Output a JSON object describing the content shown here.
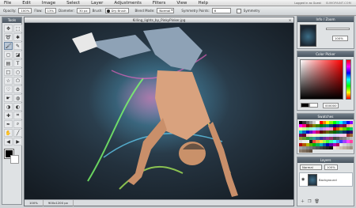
{
  "menu": {
    "items": [
      "File",
      "Edit",
      "Image",
      "Select",
      "Layer",
      "Adjustments",
      "Filters",
      "View",
      "Help"
    ],
    "logged_in": "Logged in as Guest",
    "brand": "SUMOPAINT.COM"
  },
  "options": {
    "opacity_label": "Opacity:",
    "opacity_value": "100%",
    "flow_label": "Flow:",
    "flow_value": "13%",
    "diameter_label": "Diameter:",
    "diameter_value": "30 px",
    "brush_label": "Brush:",
    "brush_value": "Dry Brush",
    "blend_label": "Blend Mode:",
    "blend_value": "Normal",
    "symmetry_points_label": "Symmetry Points:",
    "symmetry_points_value": "6",
    "symmetry_label": "Symmetry"
  },
  "tools": {
    "title": "Tools",
    "icons": [
      "move-icon",
      "marquee-icon",
      "lasso-icon",
      "magic-wand-icon",
      "brush-icon",
      "pencil-icon",
      "eraser-icon",
      "bucket-icon",
      "gradient-icon",
      "text-icon",
      "shape-rect-icon",
      "shape-ellipse-icon",
      "star-icon",
      "polygon-icon",
      "heart-icon",
      "gear-icon",
      "smudge-icon",
      "blur-icon",
      "dodge-icon",
      "burn-icon",
      "clone-icon",
      "crop-icon",
      "eyedropper-icon",
      "zoom-icon",
      "hand-icon",
      "line-icon",
      "arrow-left-icon",
      "arrow-right-icon"
    ],
    "glyphs": [
      "✥",
      "⬚",
      "➰",
      "✱",
      "🖌",
      "✎",
      "◻",
      "◪",
      "▤",
      "T",
      "□",
      "○",
      "☆",
      "⬠",
      "♡",
      "⚙",
      "☛",
      "◍",
      "◑",
      "◐",
      "✚",
      "⌗",
      "✒",
      "⌕",
      "✋",
      "╱",
      "◀",
      "▶"
    ],
    "active_index": 4
  },
  "document": {
    "title": "Killing_lights_by_PinkyPinker.jpg",
    "zoom": "100%",
    "size": "900x1200 px"
  },
  "panels": {
    "info_title": "Info / Zoom",
    "info_zoom": "100%",
    "color_picker_title": "Color Picker",
    "hex": "000000",
    "swatches_title": "Swatches",
    "layers_title": "Layers",
    "layer_mode": "Normal",
    "layer_opacity": "100%",
    "layer_name": "Background"
  },
  "swatches": [
    "#000000",
    "#333333",
    "#666666",
    "#999999",
    "#cccccc",
    "#ffffff",
    "#ff0000",
    "#ff8000",
    "#ffff00",
    "#80ff00",
    "#00ff00",
    "#00ff80",
    "#00ffff",
    "#0080ff",
    "#0000ff",
    "#8000ff",
    "#ff00ff",
    "#ff0080",
    "#800000",
    "#804000",
    "#808000",
    "#408000",
    "#008000",
    "#008040",
    "#008080",
    "#004080",
    "#000080",
    "#400080",
    "#800080",
    "#800040",
    "#ff9999",
    "#ffcc99",
    "#ffff99",
    "#ccff99",
    "#99ff99",
    "#99ffcc",
    "#99ffff",
    "#99ccff",
    "#9999ff",
    "#cc99ff",
    "#ff99ff",
    "#ff99cc",
    "#cc0000",
    "#cc6600",
    "#cccc00",
    "#66cc00",
    "#00cc00",
    "#00cc66",
    "#00cccc",
    "#0066cc",
    "#0000cc",
    "#6600cc",
    "#cc00cc",
    "#cc0066",
    "#660000",
    "#663300",
    "#666600",
    "#336600",
    "#006600",
    "#006633",
    "#006666",
    "#003366",
    "#000066",
    "#330066",
    "#660066",
    "#660033",
    "#ffcccc",
    "#ffe5cc",
    "#ffffcc",
    "#e5ffcc",
    "#ccffcc",
    "#ccffe5",
    "#ccffff",
    "#cce5ff",
    "#ccccff",
    "#e5ccff",
    "#ffccff",
    "#ffcce5",
    "#993333",
    "#996633",
    "#999933",
    "#669933",
    "#339933",
    "#339966",
    "#339999",
    "#336699",
    "#333399",
    "#663399",
    "#993399",
    "#993366",
    "#444444",
    "#555555",
    "#777777",
    "#888888",
    "#aaaaaa",
    "#bbbbbb",
    "#dddddd",
    "#eeeeee",
    "#f2f2f2",
    "#1a1a1a",
    "#ff4040",
    "#ffa040",
    "#ffe040",
    "#a0ff40",
    "#40ff40",
    "#40ffa0",
    "#40ffff",
    "#40a0ff",
    "#4040ff",
    "#a040ff",
    "#ff40ff",
    "#ff40a0",
    "#b30000",
    "#b35900",
    "#b3b300",
    "#59b300",
    "#00b300",
    "#00b359",
    "#00b3b3",
    "#0059b3",
    "#0000b3",
    "#5900b3",
    "#b300b3",
    "#b30059",
    "#e6e6e6",
    "#d4d4d4",
    "#c4c4c4",
    "#b4b4b4",
    "#a4a4a4",
    "#949494",
    "#848484",
    "#747474",
    "#646464",
    "#545454",
    "#444444",
    "#343434",
    "#242424",
    "#141414",
    "#f0e0d0",
    "#e0d0c0",
    "#d0c0b0",
    "#c0b0a0",
    "#b0a090",
    "#a09080",
    "#908070",
    "#807060",
    "#706050",
    "#605040"
  ]
}
